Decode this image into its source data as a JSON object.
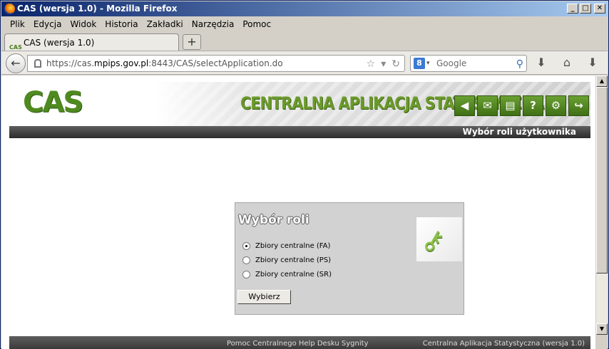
{
  "window": {
    "title": "CAS (wersja 1.0) - Mozilla Firefox",
    "controls": [
      "_",
      "□",
      "✕"
    ]
  },
  "menu": [
    "Plik",
    "Edycja",
    "Widok",
    "Historia",
    "Zakładki",
    "Narzędzia",
    "Pomoc"
  ],
  "tab": {
    "favicon_text": "CAS",
    "title": "CAS (wersja 1.0)",
    "new_tab": "+"
  },
  "navbar": {
    "url_prefix": "https://cas.",
    "url_domain": "mpips.gov.pl",
    "url_suffix": ":8443/CAS/selectApplication.do",
    "search_placeholder": "Google",
    "search_engine_letter": "8"
  },
  "header": {
    "logo": "CAS",
    "app_title": "CENTRALNA APLIKACJA STATYSTYCZNA",
    "subbar_text": "Wybór roli użytkownika",
    "icons": [
      "back-icon",
      "mail-icon",
      "document-icon",
      "help-icon",
      "settings-icon",
      "exit-icon"
    ]
  },
  "panel": {
    "title": "Wybór roli",
    "options": [
      {
        "label": "Zbiory centralne (FA)",
        "selected": true
      },
      {
        "label": "Zbiory centralne (PS)",
        "selected": false
      },
      {
        "label": "Zbiory centralne (SR)",
        "selected": false
      }
    ],
    "button": "Wybierz"
  },
  "footer": {
    "left": "Pomoc Centralnego Help Desku Sygnity",
    "right": "Centralna Aplikacja Statystyczna (wersja 1.0)"
  }
}
